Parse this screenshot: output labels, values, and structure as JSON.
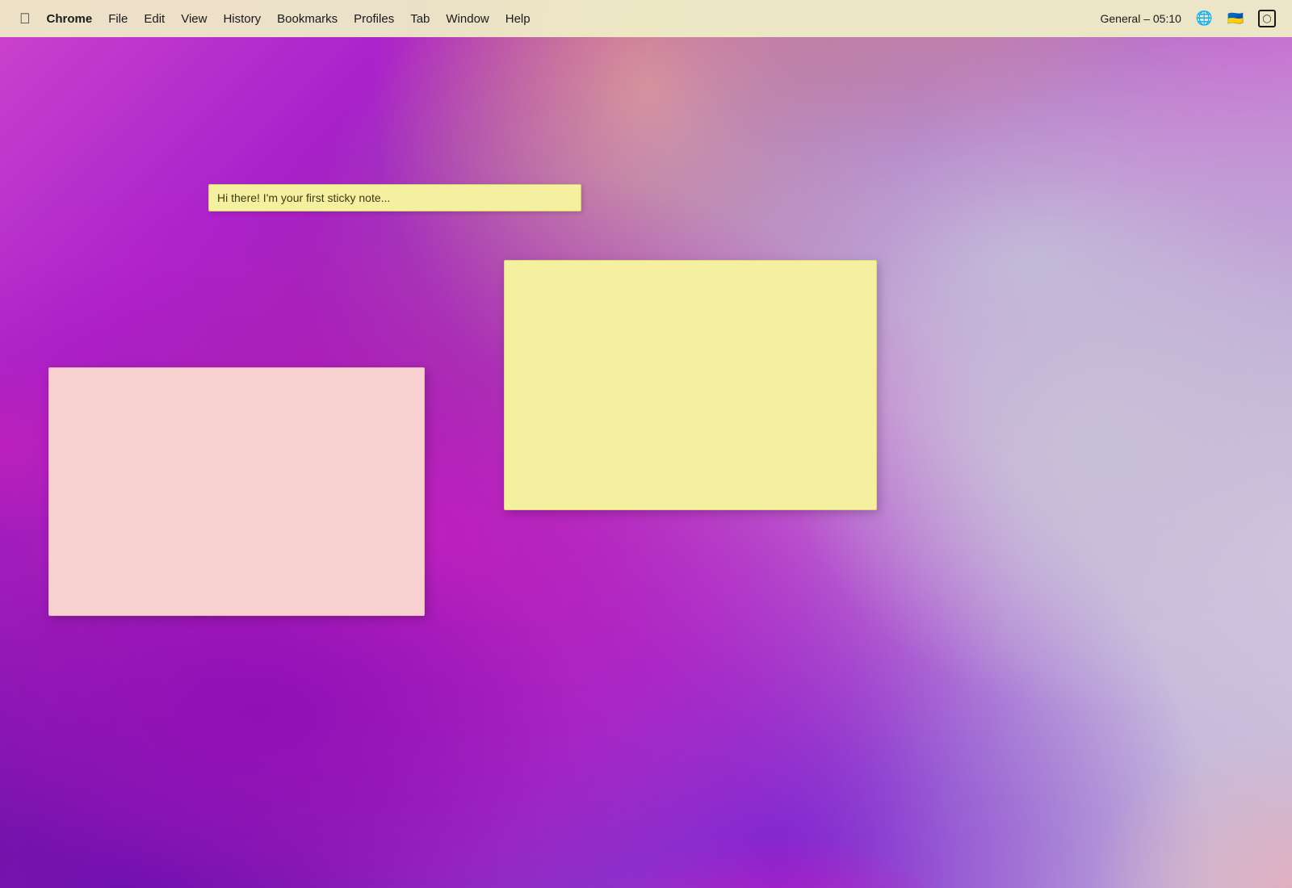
{
  "menubar": {
    "apple_label": "",
    "items": [
      {
        "id": "chrome",
        "label": "Chrome",
        "bold": true
      },
      {
        "id": "file",
        "label": "File"
      },
      {
        "id": "edit",
        "label": "Edit"
      },
      {
        "id": "view",
        "label": "View"
      },
      {
        "id": "history",
        "label": "History"
      },
      {
        "id": "bookmarks",
        "label": "Bookmarks"
      },
      {
        "id": "profiles",
        "label": "Profiles"
      },
      {
        "id": "tab",
        "label": "Tab"
      },
      {
        "id": "window",
        "label": "Window"
      },
      {
        "id": "help",
        "label": "Help"
      }
    ],
    "right": {
      "time": "General – 05:10"
    }
  },
  "sticky_notes": {
    "inline": {
      "text": "Hi there! I'm your first sticky note..."
    },
    "yellow": {
      "text": ""
    },
    "pink": {
      "text": ""
    }
  }
}
